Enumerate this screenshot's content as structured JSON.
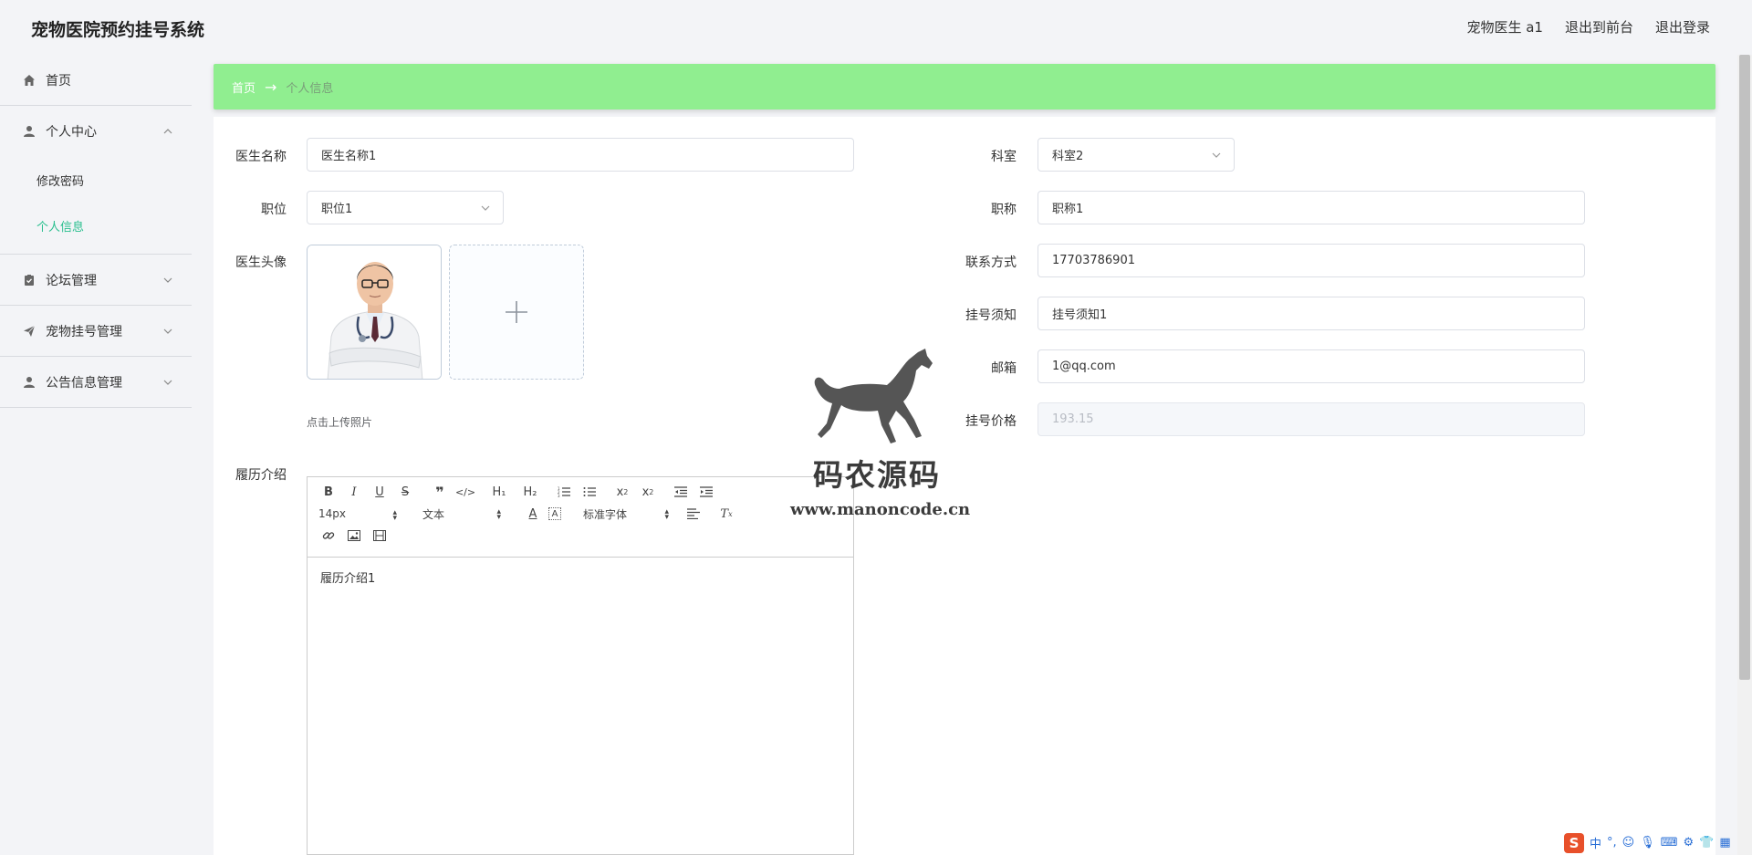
{
  "app": {
    "title": "宠物医院预约挂号系统"
  },
  "header": {
    "user_label": "宠物医生 a1",
    "back_frontend": "退出到前台",
    "logout": "退出登录"
  },
  "sidebar": {
    "items": [
      {
        "label": "首页",
        "icon": "home-icon"
      },
      {
        "label": "个人中心",
        "icon": "user-icon",
        "open": true,
        "children": [
          {
            "label": "修改密码"
          },
          {
            "label": "个人信息",
            "active": true
          }
        ]
      },
      {
        "label": "论坛管理",
        "icon": "clipboard-icon"
      },
      {
        "label": "宠物挂号管理",
        "icon": "send-icon"
      },
      {
        "label": "公告信息管理",
        "icon": "user-icon"
      }
    ]
  },
  "breadcrumb": {
    "home": "首页",
    "arrow": "→",
    "current": "个人信息"
  },
  "form": {
    "doctor_name": {
      "label": "医生名称",
      "value": "医生名称1"
    },
    "department": {
      "label": "科室",
      "value": "科室2"
    },
    "position": {
      "label": "职位",
      "value": "职位1"
    },
    "title": {
      "label": "职称",
      "value": "职称1"
    },
    "avatar": {
      "label": "医生头像",
      "upload_tip": "点击上传照片",
      "upload_icon": "plus-icon"
    },
    "contact": {
      "label": "联系方式",
      "value": "17703786901"
    },
    "notice": {
      "label": "挂号须知",
      "value": "挂号须知1"
    },
    "email": {
      "label": "邮箱",
      "value": "1@qq.com"
    },
    "price": {
      "label": "挂号价格",
      "value": "193.15"
    },
    "resume": {
      "label": "履历介绍",
      "content": "履历介绍1",
      "toolbar": {
        "font_size": "14px",
        "text_style": "文本",
        "font_family": "标准字体",
        "buttons": [
          "bold-icon",
          "italic-icon",
          "underline-icon",
          "strike-icon",
          "quote-icon",
          "code-icon",
          "h1-icon",
          "h2-icon",
          "ordered-list-icon",
          "bullet-list-icon",
          "subscript-icon",
          "superscript-icon",
          "outdent-icon",
          "indent-icon",
          "font-color-icon",
          "background-color-icon",
          "align-icon",
          "clear-format-icon",
          "link-icon",
          "image-icon",
          "video-icon"
        ],
        "h1": "H₁",
        "h2": "H₂"
      }
    }
  },
  "watermark": {
    "title": "码农源码",
    "url": "www.manoncode.cn"
  },
  "ime": {
    "lang": "中",
    "punct": "°,",
    "logo": "S"
  },
  "colors": {
    "breadcrumb_bg": "#90ee90",
    "active_menu": "#2bbf8f",
    "page_bg": "#f3f4f7"
  }
}
